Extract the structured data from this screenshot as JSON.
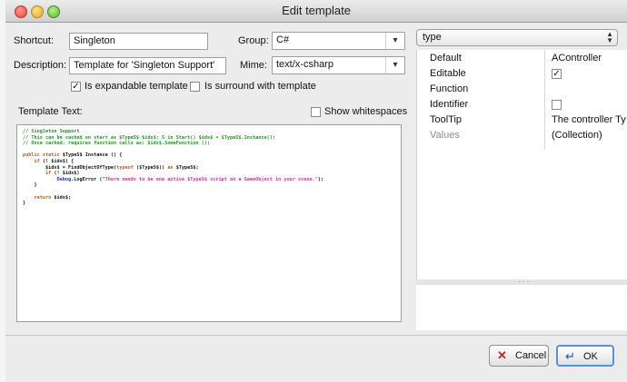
{
  "window": {
    "title": "Edit template"
  },
  "form": {
    "shortcut_label": "Shortcut:",
    "shortcut_value": "Singleton",
    "group_label": "Group:",
    "group_value": "C#",
    "description_label": "Description:",
    "description_value": "Template for 'Singleton Support'",
    "mime_label": "Mime:",
    "mime_value": "text/x-csharp",
    "expandable_label": "Is expandable template",
    "expandable_checked": true,
    "surround_label": "Is surround with template",
    "surround_checked": false,
    "template_text_label": "Template Text:",
    "show_whitespaces_label": "Show whitespaces",
    "show_whitespaces_checked": false
  },
  "code": [
    [
      {
        "t": "// Singleton Support",
        "c": "com"
      }
    ],
    [
      {
        "t": "// This can be cached on start as $TypeS$ $ids$; S in Start() $ids$ = $TypeS$.Instance();",
        "c": "com"
      }
    ],
    [
      {
        "t": "// Once cached, requires function calls as: $ids$.SomeFunction ();",
        "c": "com"
      }
    ],
    [
      {
        "t": "",
        "c": "pl"
      }
    ],
    [
      {
        "t": "public static ",
        "c": "kw"
      },
      {
        "t": "$TypeS$ Instance () {",
        "c": "pl"
      }
    ],
    [
      {
        "t": "    if ",
        "c": "kw"
      },
      {
        "t": "(! $ids$) {",
        "c": "pl"
      }
    ],
    [
      {
        "t": "        $ids$ = FindObjectOfType(",
        "c": "pl"
      },
      {
        "t": "typeof ",
        "c": "kw"
      },
      {
        "t": "($TypeS$)) ",
        "c": "pl"
      },
      {
        "t": "as ",
        "c": "kw"
      },
      {
        "t": "$TypeS$;",
        "c": "pl"
      }
    ],
    [
      {
        "t": "        if ",
        "c": "kw"
      },
      {
        "t": "(! $ids$)",
        "c": "pl"
      }
    ],
    [
      {
        "t": "            Debug",
        "c": "id"
      },
      {
        "t": ".LogError (",
        "c": "pl"
      },
      {
        "t": "\"There needs to be one active $TypeS$ script on a GameObject in your scene.\"",
        "c": "str"
      },
      {
        "t": ");",
        "c": "pl"
      }
    ],
    [
      {
        "t": "    }",
        "c": "pl"
      }
    ],
    [
      {
        "t": "",
        "c": "pl"
      }
    ],
    [
      {
        "t": "    return ",
        "c": "kw"
      },
      {
        "t": "$ids$;",
        "c": "pl"
      }
    ],
    [
      {
        "t": "}",
        "c": "pl"
      }
    ]
  ],
  "properties": {
    "type_selector": "type",
    "rows": [
      {
        "name": "Default",
        "value": "AController",
        "kind": "text",
        "enabled": true
      },
      {
        "name": "Editable",
        "value": "",
        "kind": "check",
        "checked": true,
        "enabled": true
      },
      {
        "name": "Function",
        "value": "",
        "kind": "text",
        "enabled": true
      },
      {
        "name": "Identifier",
        "value": "",
        "kind": "check",
        "checked": false,
        "enabled": true
      },
      {
        "name": "ToolTip",
        "value": "The controller Ty",
        "kind": "text",
        "enabled": true
      },
      {
        "name": "Values",
        "value": "(Collection)",
        "kind": "text",
        "enabled": false
      }
    ]
  },
  "buttons": {
    "cancel_label": "Cancel",
    "ok_label": "OK"
  }
}
